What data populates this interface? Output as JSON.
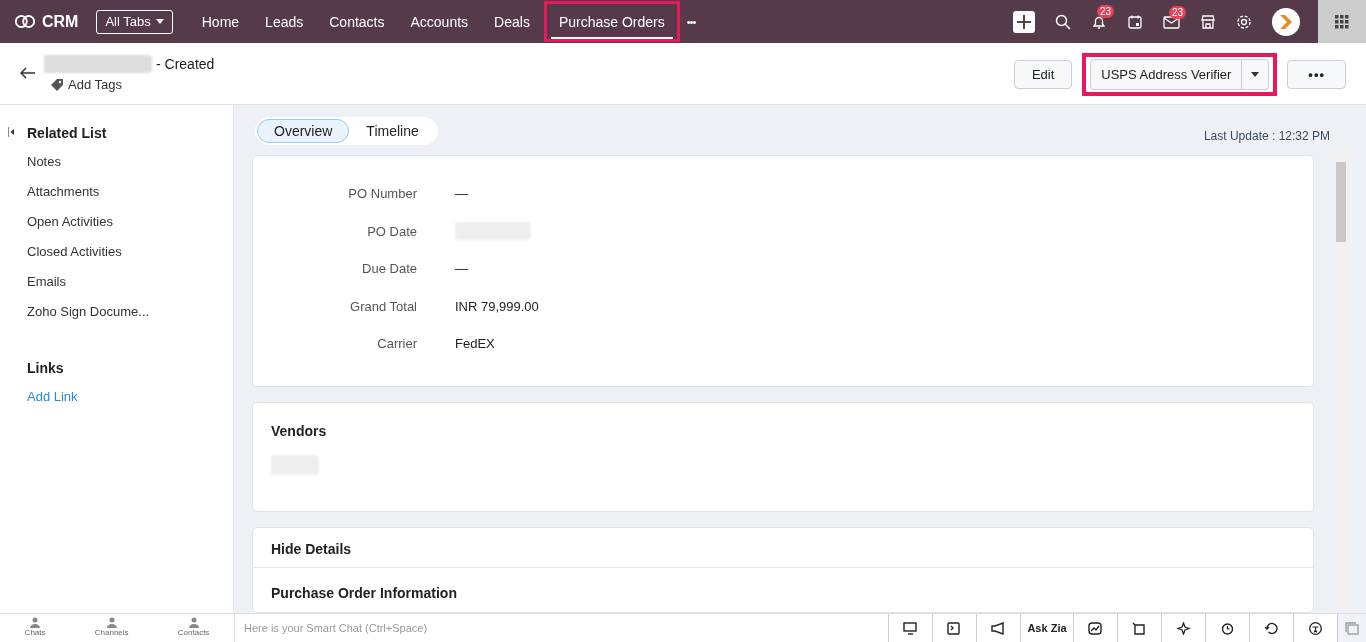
{
  "topbar": {
    "logo": "CRM",
    "all_tabs": "All Tabs",
    "tabs": [
      {
        "label": "Home",
        "selected": false,
        "highlighted": false
      },
      {
        "label": "Leads",
        "selected": false,
        "highlighted": false
      },
      {
        "label": "Contacts",
        "selected": false,
        "highlighted": false
      },
      {
        "label": "Accounts",
        "selected": false,
        "highlighted": false
      },
      {
        "label": "Deals",
        "selected": false,
        "highlighted": false
      },
      {
        "label": "Purchase Orders",
        "selected": true,
        "highlighted": true
      }
    ],
    "more": "•••",
    "notifications_badge": "23",
    "mail_badge": "23"
  },
  "header": {
    "title_suffix": "- Created",
    "add_tags": "Add Tags",
    "edit": "Edit",
    "verifier": {
      "label": "USPS Address Verifier",
      "highlighted": true
    },
    "more": "•••"
  },
  "sidebar": {
    "related_title": "Related List",
    "related": [
      "Notes",
      "Attachments",
      "Open Activities",
      "Closed Activities",
      "Emails",
      "Zoho Sign Docume..."
    ],
    "links_title": "Links",
    "add_link": "Add Link"
  },
  "view_tabs": [
    {
      "label": "Overview",
      "selected": true
    },
    {
      "label": "Timeline",
      "selected": false
    }
  ],
  "last_update": "Last Update : 12:32 PM",
  "fields": [
    {
      "label": "PO Number",
      "kind": "text",
      "value": "—"
    },
    {
      "label": "PO Date",
      "kind": "redacted"
    },
    {
      "label": "Due Date",
      "kind": "text",
      "value": "—"
    },
    {
      "label": "Grand Total",
      "kind": "text",
      "value": "INR 79,999.00"
    },
    {
      "label": "Carrier",
      "kind": "text",
      "value": "FedEX"
    }
  ],
  "vendors": {
    "title": "Vendors"
  },
  "details": {
    "toggle": "Hide Details",
    "section": "Purchase Order Information"
  },
  "bottom": {
    "items": [
      "Chats",
      "Channels",
      "Contacts"
    ],
    "smart_chat": {
      "placeholder": "Here is your Smart Chat (Ctrl+Space)"
    },
    "ask_zia": "Ask Zia"
  }
}
